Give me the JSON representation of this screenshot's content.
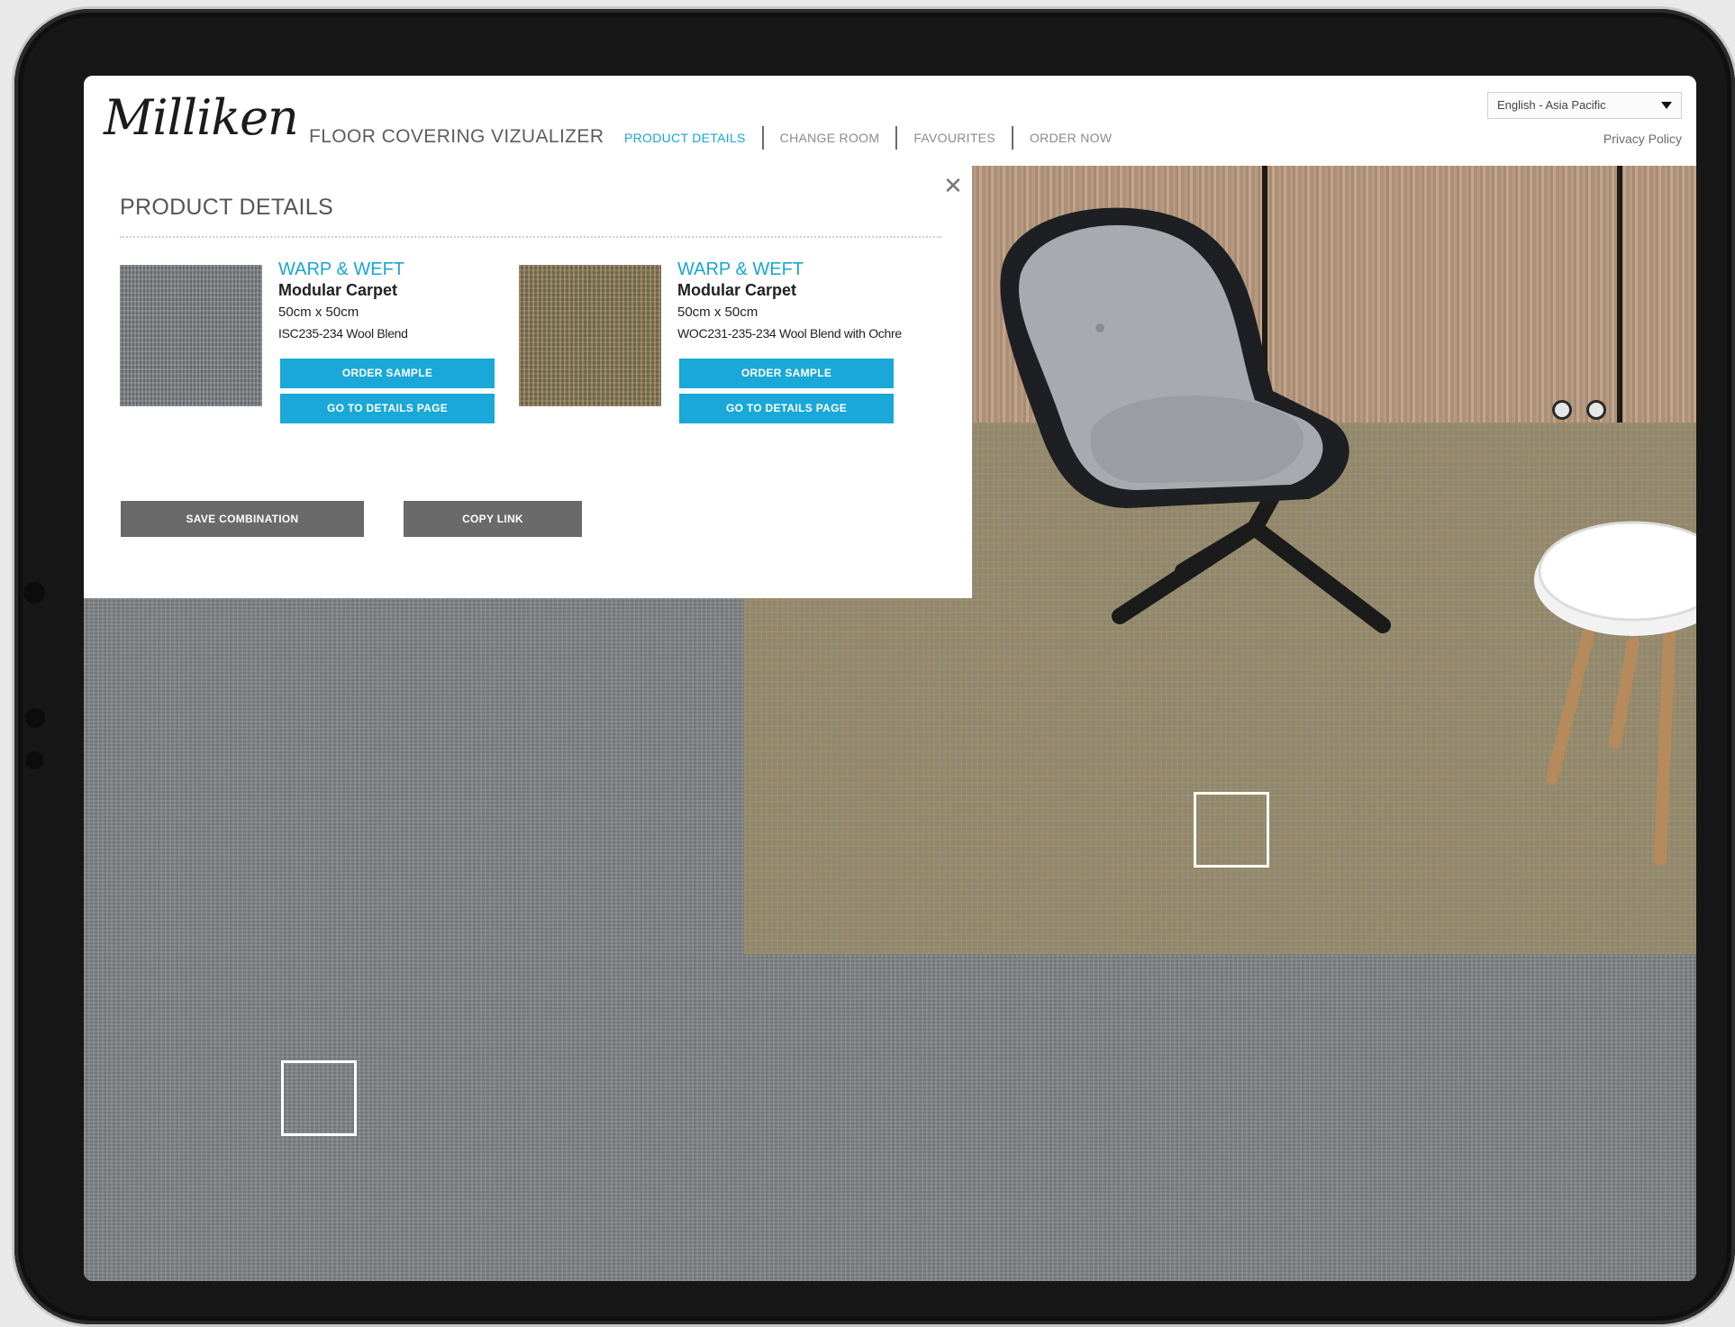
{
  "header": {
    "logo_text": "Milliken",
    "app_title": "FLOOR COVERING VIZUALIZER",
    "nav": [
      {
        "label": "PRODUCT DETAILS",
        "active": true
      },
      {
        "label": "CHANGE ROOM",
        "active": false
      },
      {
        "label": "FAVOURITES",
        "active": false
      },
      {
        "label": "ORDER NOW",
        "active": false
      }
    ],
    "language": "English - Asia Pacific",
    "privacy_label": "Privacy Policy"
  },
  "panel": {
    "title": "PRODUCT DETAILS",
    "close_symbol": "✕",
    "products": [
      {
        "brand": "WARP & WEFT",
        "type": "Modular Carpet",
        "size": "50cm x 50cm",
        "code": "ISC235-234 Wool Blend",
        "order_label": "ORDER SAMPLE",
        "details_label": "GO TO DETAILS PAGE"
      },
      {
        "brand": "WARP & WEFT",
        "type": "Modular Carpet",
        "size": "50cm x 50cm",
        "code": "WOC231-235-234 Wool Blend with Ochre",
        "order_label": "ORDER SAMPLE",
        "details_label": "GO TO DETAILS PAGE"
      }
    ],
    "save_label": "SAVE COMBINATION",
    "copy_label": "COPY LINK"
  },
  "colors": {
    "accent": "#1aa5d4",
    "button_gray": "#6a6a6a",
    "text_dark": "#222222"
  }
}
